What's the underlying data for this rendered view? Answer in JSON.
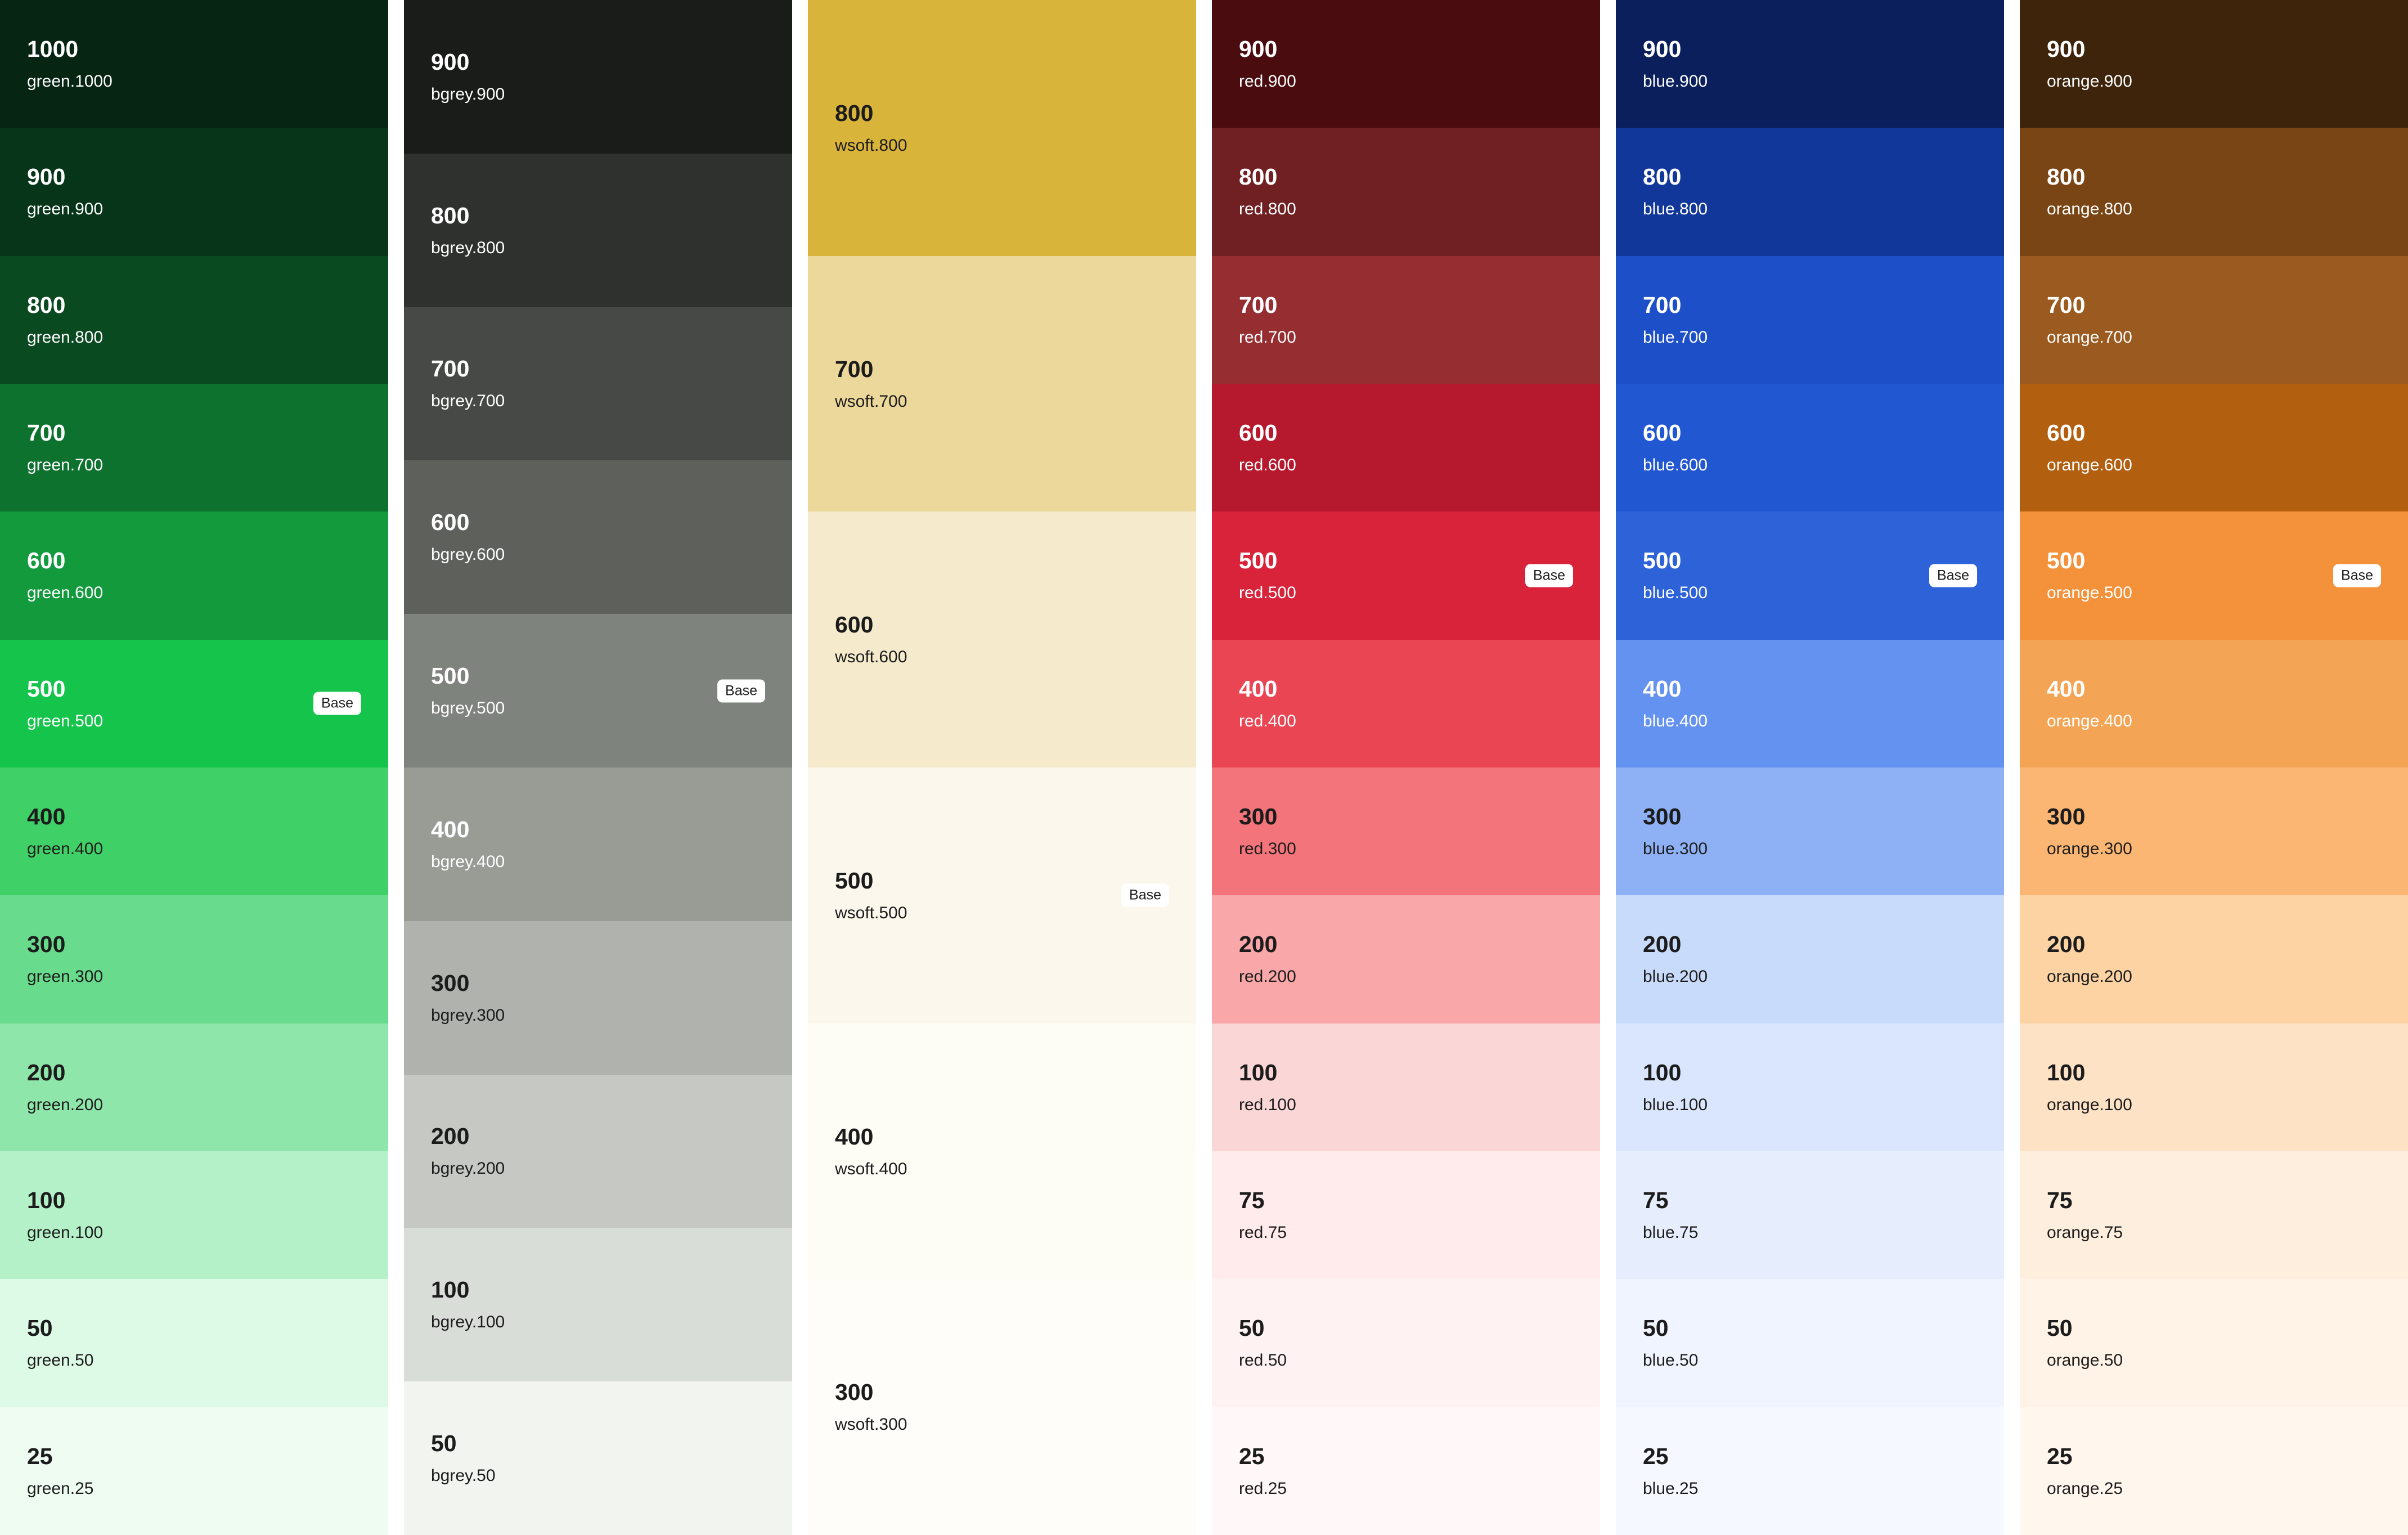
{
  "columns": [
    {
      "family": "green",
      "swatches": [
        {
          "num": "1000",
          "name": "green.1000",
          "color": "#062512",
          "tone": "dark"
        },
        {
          "num": "900",
          "name": "green.900",
          "color": "#063519",
          "tone": "dark"
        },
        {
          "num": "800",
          "name": "green.800",
          "color": "#0a4a21",
          "tone": "dark"
        },
        {
          "num": "700",
          "name": "green.700",
          "color": "#0e722f",
          "tone": "dark"
        },
        {
          "num": "600",
          "name": "green.600",
          "color": "#129a3d",
          "tone": "dark"
        },
        {
          "num": "500",
          "name": "green.500",
          "color": "#15c44b",
          "tone": "dark",
          "badge": "Base"
        },
        {
          "num": "400",
          "name": "green.400",
          "color": "#3fd068",
          "tone": "light"
        },
        {
          "num": "300",
          "name": "green.300",
          "color": "#68dc8c",
          "tone": "light"
        },
        {
          "num": "200",
          "name": "green.200",
          "color": "#8fe6aa",
          "tone": "light"
        },
        {
          "num": "100",
          "name": "green.100",
          "color": "#b5f1c8",
          "tone": "light"
        },
        {
          "num": "50",
          "name": "green.50",
          "color": "#ddfae6",
          "tone": "light"
        },
        {
          "num": "25",
          "name": "green.25",
          "color": "#eefcf2",
          "tone": "light"
        }
      ]
    },
    {
      "family": "bgrey",
      "swatches": [
        {
          "num": "900",
          "name": "bgrey.900",
          "color": "#1a1c1a",
          "tone": "dark"
        },
        {
          "num": "800",
          "name": "bgrey.800",
          "color": "#2f312f",
          "tone": "dark"
        },
        {
          "num": "700",
          "name": "bgrey.700",
          "color": "#464946",
          "tone": "dark"
        },
        {
          "num": "600",
          "name": "bgrey.600",
          "color": "#5d605b",
          "tone": "dark"
        },
        {
          "num": "500",
          "name": "bgrey.500",
          "color": "#7f837e",
          "tone": "dark",
          "badge": "Base"
        },
        {
          "num": "400",
          "name": "bgrey.400",
          "color": "#999b95",
          "tone": "dark"
        },
        {
          "num": "300",
          "name": "bgrey.300",
          "color": "#b0b2ad",
          "tone": "light"
        },
        {
          "num": "200",
          "name": "bgrey.200",
          "color": "#c6c8c3",
          "tone": "light"
        },
        {
          "num": "100",
          "name": "bgrey.100",
          "color": "#d9ddd8",
          "tone": "light"
        },
        {
          "num": "50",
          "name": "bgrey.50",
          "color": "#f2f4f0",
          "tone": "light"
        }
      ]
    },
    {
      "family": "wsoft",
      "swatches": [
        {
          "num": "800",
          "name": "wsoft.800",
          "color": "#d9b43b",
          "tone": "light"
        },
        {
          "num": "700",
          "name": "wsoft.700",
          "color": "#ebd89a",
          "tone": "light"
        },
        {
          "num": "600",
          "name": "wsoft.600",
          "color": "#f5ebcc",
          "tone": "light"
        },
        {
          "num": "500",
          "name": "wsoft.500",
          "color": "#fbf7ec",
          "tone": "light",
          "badge": "Base"
        },
        {
          "num": "400",
          "name": "wsoft.400",
          "color": "#fdfdf6",
          "tone": "light"
        },
        {
          "num": "300",
          "name": "wsoft.300",
          "color": "#fefdf9",
          "tone": "light"
        }
      ]
    },
    {
      "family": "red",
      "swatches": [
        {
          "num": "900",
          "name": "red.900",
          "color": "#4a0c0f",
          "tone": "dark"
        },
        {
          "num": "800",
          "name": "red.800",
          "color": "#701f22",
          "tone": "dark"
        },
        {
          "num": "700",
          "name": "red.700",
          "color": "#952d31",
          "tone": "dark"
        },
        {
          "num": "600",
          "name": "red.600",
          "color": "#b6192e",
          "tone": "dark"
        },
        {
          "num": "500",
          "name": "red.500",
          "color": "#d8233a",
          "tone": "dark",
          "badge": "Base"
        },
        {
          "num": "400",
          "name": "red.400",
          "color": "#ea4553",
          "tone": "dark"
        },
        {
          "num": "300",
          "name": "red.300",
          "color": "#f3747a",
          "tone": "light"
        },
        {
          "num": "200",
          "name": "red.200",
          "color": "#f9a7a8",
          "tone": "light"
        },
        {
          "num": "100",
          "name": "red.100",
          "color": "#fbd6d6",
          "tone": "light"
        },
        {
          "num": "75",
          "name": "red.75",
          "color": "#ffebeb",
          "tone": "light"
        },
        {
          "num": "50",
          "name": "red.50",
          "color": "#fff2f3",
          "tone": "light"
        },
        {
          "num": "25",
          "name": "red.25",
          "color": "#fff7f8",
          "tone": "light"
        }
      ]
    },
    {
      "family": "blue",
      "swatches": [
        {
          "num": "900",
          "name": "blue.900",
          "color": "#0a1f5c",
          "tone": "dark"
        },
        {
          "num": "800",
          "name": "blue.800",
          "color": "#12379a",
          "tone": "dark"
        },
        {
          "num": "700",
          "name": "blue.700",
          "color": "#1c4fc8",
          "tone": "dark"
        },
        {
          "num": "600",
          "name": "blue.600",
          "color": "#2257d2",
          "tone": "dark"
        },
        {
          "num": "500",
          "name": "blue.500",
          "color": "#2e62d8",
          "tone": "dark",
          "badge": "Base"
        },
        {
          "num": "400",
          "name": "blue.400",
          "color": "#6392f0",
          "tone": "dark"
        },
        {
          "num": "300",
          "name": "blue.300",
          "color": "#8eb0f5",
          "tone": "light"
        },
        {
          "num": "200",
          "name": "blue.200",
          "color": "#c9dbfb",
          "tone": "light"
        },
        {
          "num": "100",
          "name": "blue.100",
          "color": "#dae6fd",
          "tone": "light"
        },
        {
          "num": "75",
          "name": "blue.75",
          "color": "#e6eefe",
          "tone": "light"
        },
        {
          "num": "50",
          "name": "blue.50",
          "color": "#eff4fe",
          "tone": "light"
        },
        {
          "num": "25",
          "name": "blue.25",
          "color": "#f5f8ff",
          "tone": "light"
        }
      ]
    },
    {
      "family": "orange",
      "swatches": [
        {
          "num": "900",
          "name": "orange.900",
          "color": "#3d240b",
          "tone": "dark"
        },
        {
          "num": "800",
          "name": "orange.800",
          "color": "#7a4514",
          "tone": "dark"
        },
        {
          "num": "700",
          "name": "orange.700",
          "color": "#9b5a1f",
          "tone": "dark"
        },
        {
          "num": "600",
          "name": "orange.600",
          "color": "#b35f10",
          "tone": "dark"
        },
        {
          "num": "500",
          "name": "orange.500",
          "color": "#f3923a",
          "tone": "dark",
          "badge": "Base"
        },
        {
          "num": "400",
          "name": "orange.400",
          "color": "#f3a555",
          "tone": "dark"
        },
        {
          "num": "300",
          "name": "orange.300",
          "color": "#fbb673",
          "tone": "light"
        },
        {
          "num": "200",
          "name": "orange.200",
          "color": "#fdd3a4",
          "tone": "light"
        },
        {
          "num": "100",
          "name": "orange.100",
          "color": "#fde2c6",
          "tone": "light"
        },
        {
          "num": "75",
          "name": "orange.75",
          "color": "#feeedd",
          "tone": "light"
        },
        {
          "num": "50",
          "name": "orange.50",
          "color": "#fff2e6",
          "tone": "light"
        },
        {
          "num": "25",
          "name": "orange.25",
          "color": "#fff6ee",
          "tone": "light"
        }
      ]
    }
  ]
}
